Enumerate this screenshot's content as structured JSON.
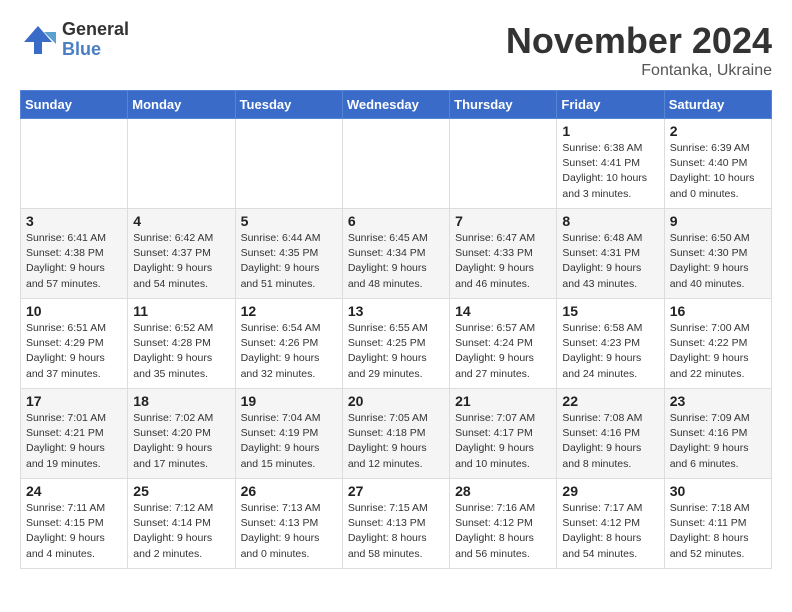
{
  "logo": {
    "general": "General",
    "blue": "Blue"
  },
  "title": "November 2024",
  "location": "Fontanka, Ukraine",
  "days_of_week": [
    "Sunday",
    "Monday",
    "Tuesday",
    "Wednesday",
    "Thursday",
    "Friday",
    "Saturday"
  ],
  "weeks": [
    [
      {
        "day": "",
        "info": ""
      },
      {
        "day": "",
        "info": ""
      },
      {
        "day": "",
        "info": ""
      },
      {
        "day": "",
        "info": ""
      },
      {
        "day": "",
        "info": ""
      },
      {
        "day": "1",
        "info": "Sunrise: 6:38 AM\nSunset: 4:41 PM\nDaylight: 10 hours\nand 3 minutes."
      },
      {
        "day": "2",
        "info": "Sunrise: 6:39 AM\nSunset: 4:40 PM\nDaylight: 10 hours\nand 0 minutes."
      }
    ],
    [
      {
        "day": "3",
        "info": "Sunrise: 6:41 AM\nSunset: 4:38 PM\nDaylight: 9 hours\nand 57 minutes."
      },
      {
        "day": "4",
        "info": "Sunrise: 6:42 AM\nSunset: 4:37 PM\nDaylight: 9 hours\nand 54 minutes."
      },
      {
        "day": "5",
        "info": "Sunrise: 6:44 AM\nSunset: 4:35 PM\nDaylight: 9 hours\nand 51 minutes."
      },
      {
        "day": "6",
        "info": "Sunrise: 6:45 AM\nSunset: 4:34 PM\nDaylight: 9 hours\nand 48 minutes."
      },
      {
        "day": "7",
        "info": "Sunrise: 6:47 AM\nSunset: 4:33 PM\nDaylight: 9 hours\nand 46 minutes."
      },
      {
        "day": "8",
        "info": "Sunrise: 6:48 AM\nSunset: 4:31 PM\nDaylight: 9 hours\nand 43 minutes."
      },
      {
        "day": "9",
        "info": "Sunrise: 6:50 AM\nSunset: 4:30 PM\nDaylight: 9 hours\nand 40 minutes."
      }
    ],
    [
      {
        "day": "10",
        "info": "Sunrise: 6:51 AM\nSunset: 4:29 PM\nDaylight: 9 hours\nand 37 minutes."
      },
      {
        "day": "11",
        "info": "Sunrise: 6:52 AM\nSunset: 4:28 PM\nDaylight: 9 hours\nand 35 minutes."
      },
      {
        "day": "12",
        "info": "Sunrise: 6:54 AM\nSunset: 4:26 PM\nDaylight: 9 hours\nand 32 minutes."
      },
      {
        "day": "13",
        "info": "Sunrise: 6:55 AM\nSunset: 4:25 PM\nDaylight: 9 hours\nand 29 minutes."
      },
      {
        "day": "14",
        "info": "Sunrise: 6:57 AM\nSunset: 4:24 PM\nDaylight: 9 hours\nand 27 minutes."
      },
      {
        "day": "15",
        "info": "Sunrise: 6:58 AM\nSunset: 4:23 PM\nDaylight: 9 hours\nand 24 minutes."
      },
      {
        "day": "16",
        "info": "Sunrise: 7:00 AM\nSunset: 4:22 PM\nDaylight: 9 hours\nand 22 minutes."
      }
    ],
    [
      {
        "day": "17",
        "info": "Sunrise: 7:01 AM\nSunset: 4:21 PM\nDaylight: 9 hours\nand 19 minutes."
      },
      {
        "day": "18",
        "info": "Sunrise: 7:02 AM\nSunset: 4:20 PM\nDaylight: 9 hours\nand 17 minutes."
      },
      {
        "day": "19",
        "info": "Sunrise: 7:04 AM\nSunset: 4:19 PM\nDaylight: 9 hours\nand 15 minutes."
      },
      {
        "day": "20",
        "info": "Sunrise: 7:05 AM\nSunset: 4:18 PM\nDaylight: 9 hours\nand 12 minutes."
      },
      {
        "day": "21",
        "info": "Sunrise: 7:07 AM\nSunset: 4:17 PM\nDaylight: 9 hours\nand 10 minutes."
      },
      {
        "day": "22",
        "info": "Sunrise: 7:08 AM\nSunset: 4:16 PM\nDaylight: 9 hours\nand 8 minutes."
      },
      {
        "day": "23",
        "info": "Sunrise: 7:09 AM\nSunset: 4:16 PM\nDaylight: 9 hours\nand 6 minutes."
      }
    ],
    [
      {
        "day": "24",
        "info": "Sunrise: 7:11 AM\nSunset: 4:15 PM\nDaylight: 9 hours\nand 4 minutes."
      },
      {
        "day": "25",
        "info": "Sunrise: 7:12 AM\nSunset: 4:14 PM\nDaylight: 9 hours\nand 2 minutes."
      },
      {
        "day": "26",
        "info": "Sunrise: 7:13 AM\nSunset: 4:13 PM\nDaylight: 9 hours\nand 0 minutes."
      },
      {
        "day": "27",
        "info": "Sunrise: 7:15 AM\nSunset: 4:13 PM\nDaylight: 8 hours\nand 58 minutes."
      },
      {
        "day": "28",
        "info": "Sunrise: 7:16 AM\nSunset: 4:12 PM\nDaylight: 8 hours\nand 56 minutes."
      },
      {
        "day": "29",
        "info": "Sunrise: 7:17 AM\nSunset: 4:12 PM\nDaylight: 8 hours\nand 54 minutes."
      },
      {
        "day": "30",
        "info": "Sunrise: 7:18 AM\nSunset: 4:11 PM\nDaylight: 8 hours\nand 52 minutes."
      }
    ]
  ]
}
